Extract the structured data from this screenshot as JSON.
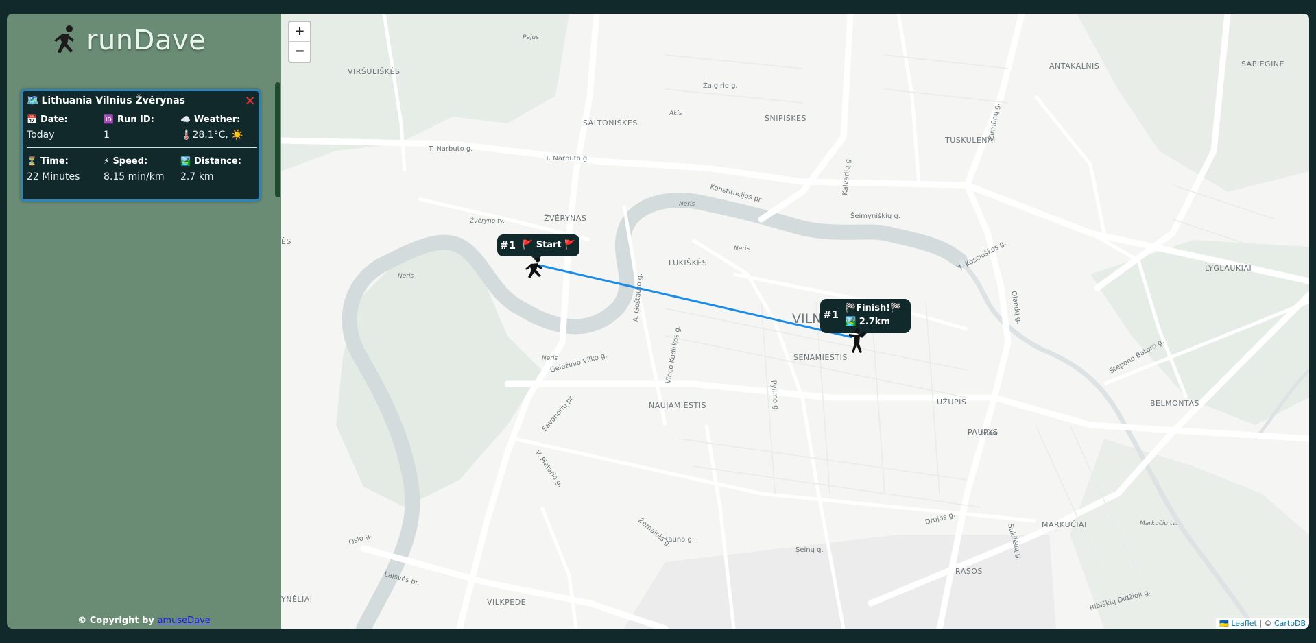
{
  "app": {
    "title": "runDave"
  },
  "run_card": {
    "location": "Lithuania Vilnius Žvėrynas",
    "date_label": "Date:",
    "date_value": "Today",
    "runid_label": "Run ID:",
    "runid_value": "1",
    "weather_label": "Weather:",
    "weather_value": "28.1°C,",
    "time_label": "Time:",
    "time_value": "22 Minutes",
    "speed_label": "Speed:",
    "speed_value": "8.15 min/km",
    "distance_label": "Distance:",
    "distance_value": "2.7 km"
  },
  "footer": {
    "prefix": "© Copyright by",
    "link": "amuseDave"
  },
  "map": {
    "zoom_in": "+",
    "zoom_out": "−",
    "start_popup": {
      "num": "#1",
      "label": "Start"
    },
    "finish_popup": {
      "num": "#1",
      "label": "Finish!",
      "distance": "2.7km"
    },
    "route_color": "#1a8ce8",
    "attribution_leaflet": "Leaflet",
    "attribution_sep": "| ©",
    "attribution_carto": "CartoDB",
    "labels": {
      "virsuliskes": "VIRŠULIŠKĖS",
      "saltoniskes": "SALTONIŠKĖS",
      "snipiskes": "ŠNIPIŠKĖS",
      "antakalnis": "ANTAKALNIS",
      "sapiegine": "SAPIEGINĖ",
      "tuskulenai": "TUSKULĖNAI",
      "zverynas": "ŽVĖRYNAS",
      "lukiskes": "LUKIŠKĖS",
      "lyglaukiai": "LYGLAUKIAI",
      "vilnius": "VILN",
      "senamiestis": "SENAMIESTIS",
      "naujamiestis": "NAUJAMIESTIS",
      "uzupis": "UŽUPIS",
      "paupys": "PAUPYS",
      "belmontas": "BELMONTAS",
      "markuciai": "MARKUČIAI",
      "rasos": "RASOS",
      "vilkpede": "VILKPĖDĖ",
      "ynelai": "YNĖLIAI",
      "es": "ĖS",
      "neris": "Neris",
      "vilnia": "Vilnia",
      "pajus": "Pajus",
      "akis": "Akis",
      "zverynotv": "Žvėryno tv.",
      "markuciu": "Markučių tv.",
      "zalgirio": "Žalgirio g.",
      "narbuto": "T. Narbuto g.",
      "konstitucijos": "Konstitucijos pr.",
      "seimyniskiu": "Šeimyniškių g.",
      "kosciuskos": "T. Kosciuškos g.",
      "olandu": "Olandų g.",
      "stepono": "Stepono Batoro g.",
      "gelezinio": "Geležinio Vilko g.",
      "savanoriu": "Savanorių pr.",
      "pietario": "V. Pietario g.",
      "zemaites": "Žemaitės g.",
      "kauno": "Kauno g.",
      "seinu": "Seinų g.",
      "drujos": "Drujos g.",
      "sukileliu": "Sukilėlių g.",
      "ribiskiu": "Ribiškių Didžioji g.",
      "laisves": "Laisvės pr.",
      "oslo": "Oslo g.",
      "pylimo": "Pylimo g.",
      "kudirkos": "Vinco Kudirkos g.",
      "gostauto": "A. Goštauto g.",
      "kalvariju": "Kalvarijų g.",
      "zirmunu": "Žirmūnų g."
    }
  }
}
